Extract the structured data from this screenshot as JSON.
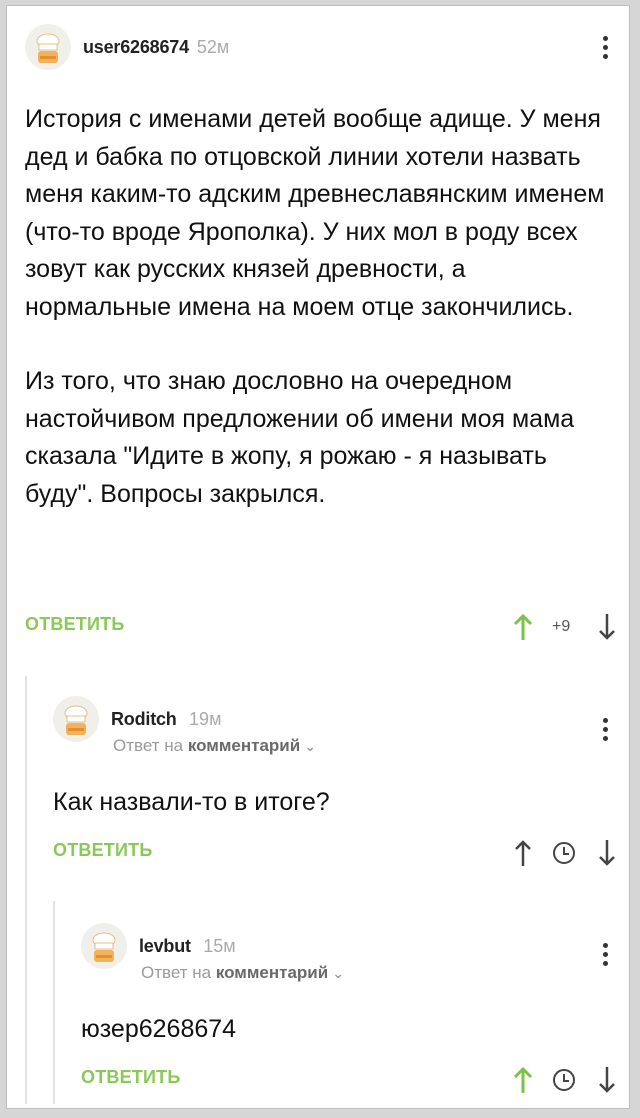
{
  "colors": {
    "accent_green": "#8ac858",
    "upvote_active": "#7cc24a",
    "neutral_icon": "#444444"
  },
  "comments": [
    {
      "username": "user6268674",
      "time": "52м",
      "paragraphs": [
        "История с именами детей вообще адище. У меня дед и бабка по отцовской линии хотели назвать меня каким-то адским древнеславянским именем (что-то вроде Ярополка). У них мол в роду всех зовут как русских князей древности, а нормальные имена на моем отце закончились.",
        "Из того, что знаю дословно на очередном настойчивом предложении об имени моя мама сказала \"Идите в жопу, я рожаю - я называть буду\". Вопросы закрылся."
      ],
      "reply_label": "ОТВЕТИТЬ",
      "score": "+9",
      "upvoted": true
    },
    {
      "username": "Roditch",
      "time": "19м",
      "reply_prefix": "Ответ на",
      "reply_target": "комментарий",
      "text": "Как назвали-то в итоге?",
      "reply_label": "ОТВЕТИТЬ",
      "upvoted": false
    },
    {
      "username": "levbut",
      "time": "15м",
      "reply_prefix": "Ответ на",
      "reply_target": "комментарий",
      "text": "юзер6268674",
      "reply_label": "ОТВЕТИТЬ",
      "upvoted": true
    }
  ],
  "icons": {
    "avatar": "chef-hat-avatar-icon",
    "menu": "kebab-menu-icon",
    "upvote": "arrow-up-icon",
    "downvote": "arrow-down-icon",
    "score_hidden": "clock-icon",
    "expand": "chevron-down-icon"
  }
}
